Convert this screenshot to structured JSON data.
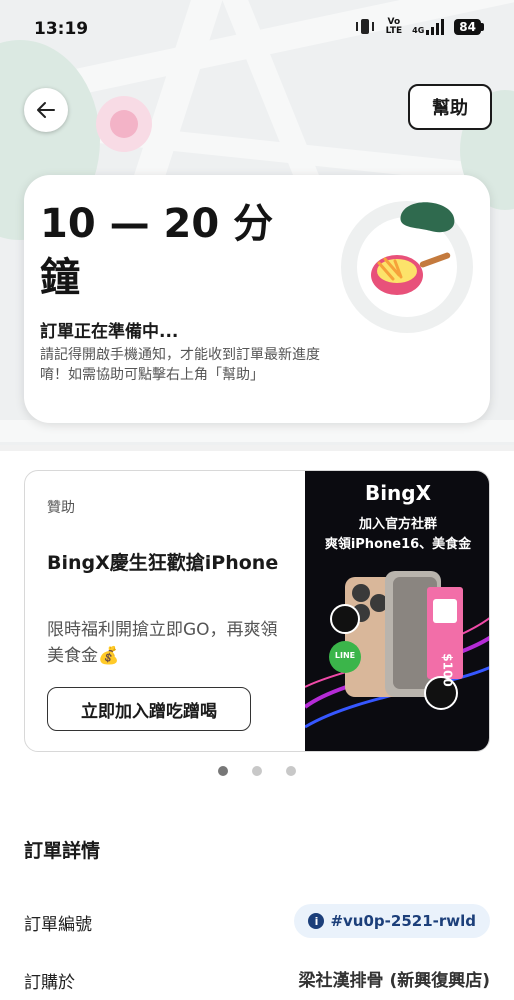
{
  "status_bar": {
    "time": "13:19",
    "network": "4G",
    "battery": "84",
    "volte": "Vo\nLTE"
  },
  "header": {
    "help_label": "幫助"
  },
  "eta": {
    "time_range": "10 — 20 分鐘",
    "status": "訂單正在準備中...",
    "description": "請記得開啟手機通知，才能收到訂單最新進度唷！如需協助可點擊右上角「幫助」"
  },
  "ad": {
    "sponsor_label": "贊助",
    "title": "BingX慶生狂歡搶iPhone",
    "description": "限時福利開搶立即GO，再爽領美食金💰",
    "cta_label": "立即加入蹭吃蹭喝",
    "image_brand": "BingX",
    "image_line1": "加入官方社群",
    "image_line2": "爽領iPhone16、美食金",
    "image_badge_line": "LINE",
    "image_coupon": "$100"
  },
  "carousel": {
    "count": 3,
    "active_index": 0
  },
  "order_details": {
    "section_title": "訂單詳情",
    "order_id_label": "訂單編號",
    "order_id": "#vu0p-2521-rwld",
    "ordered_from_label": "訂購於",
    "store_name": "梁社漢排骨 (新興復興店)"
  },
  "colors": {
    "accent": "#1c3f7a",
    "chip_bg": "#eaf2fb"
  }
}
